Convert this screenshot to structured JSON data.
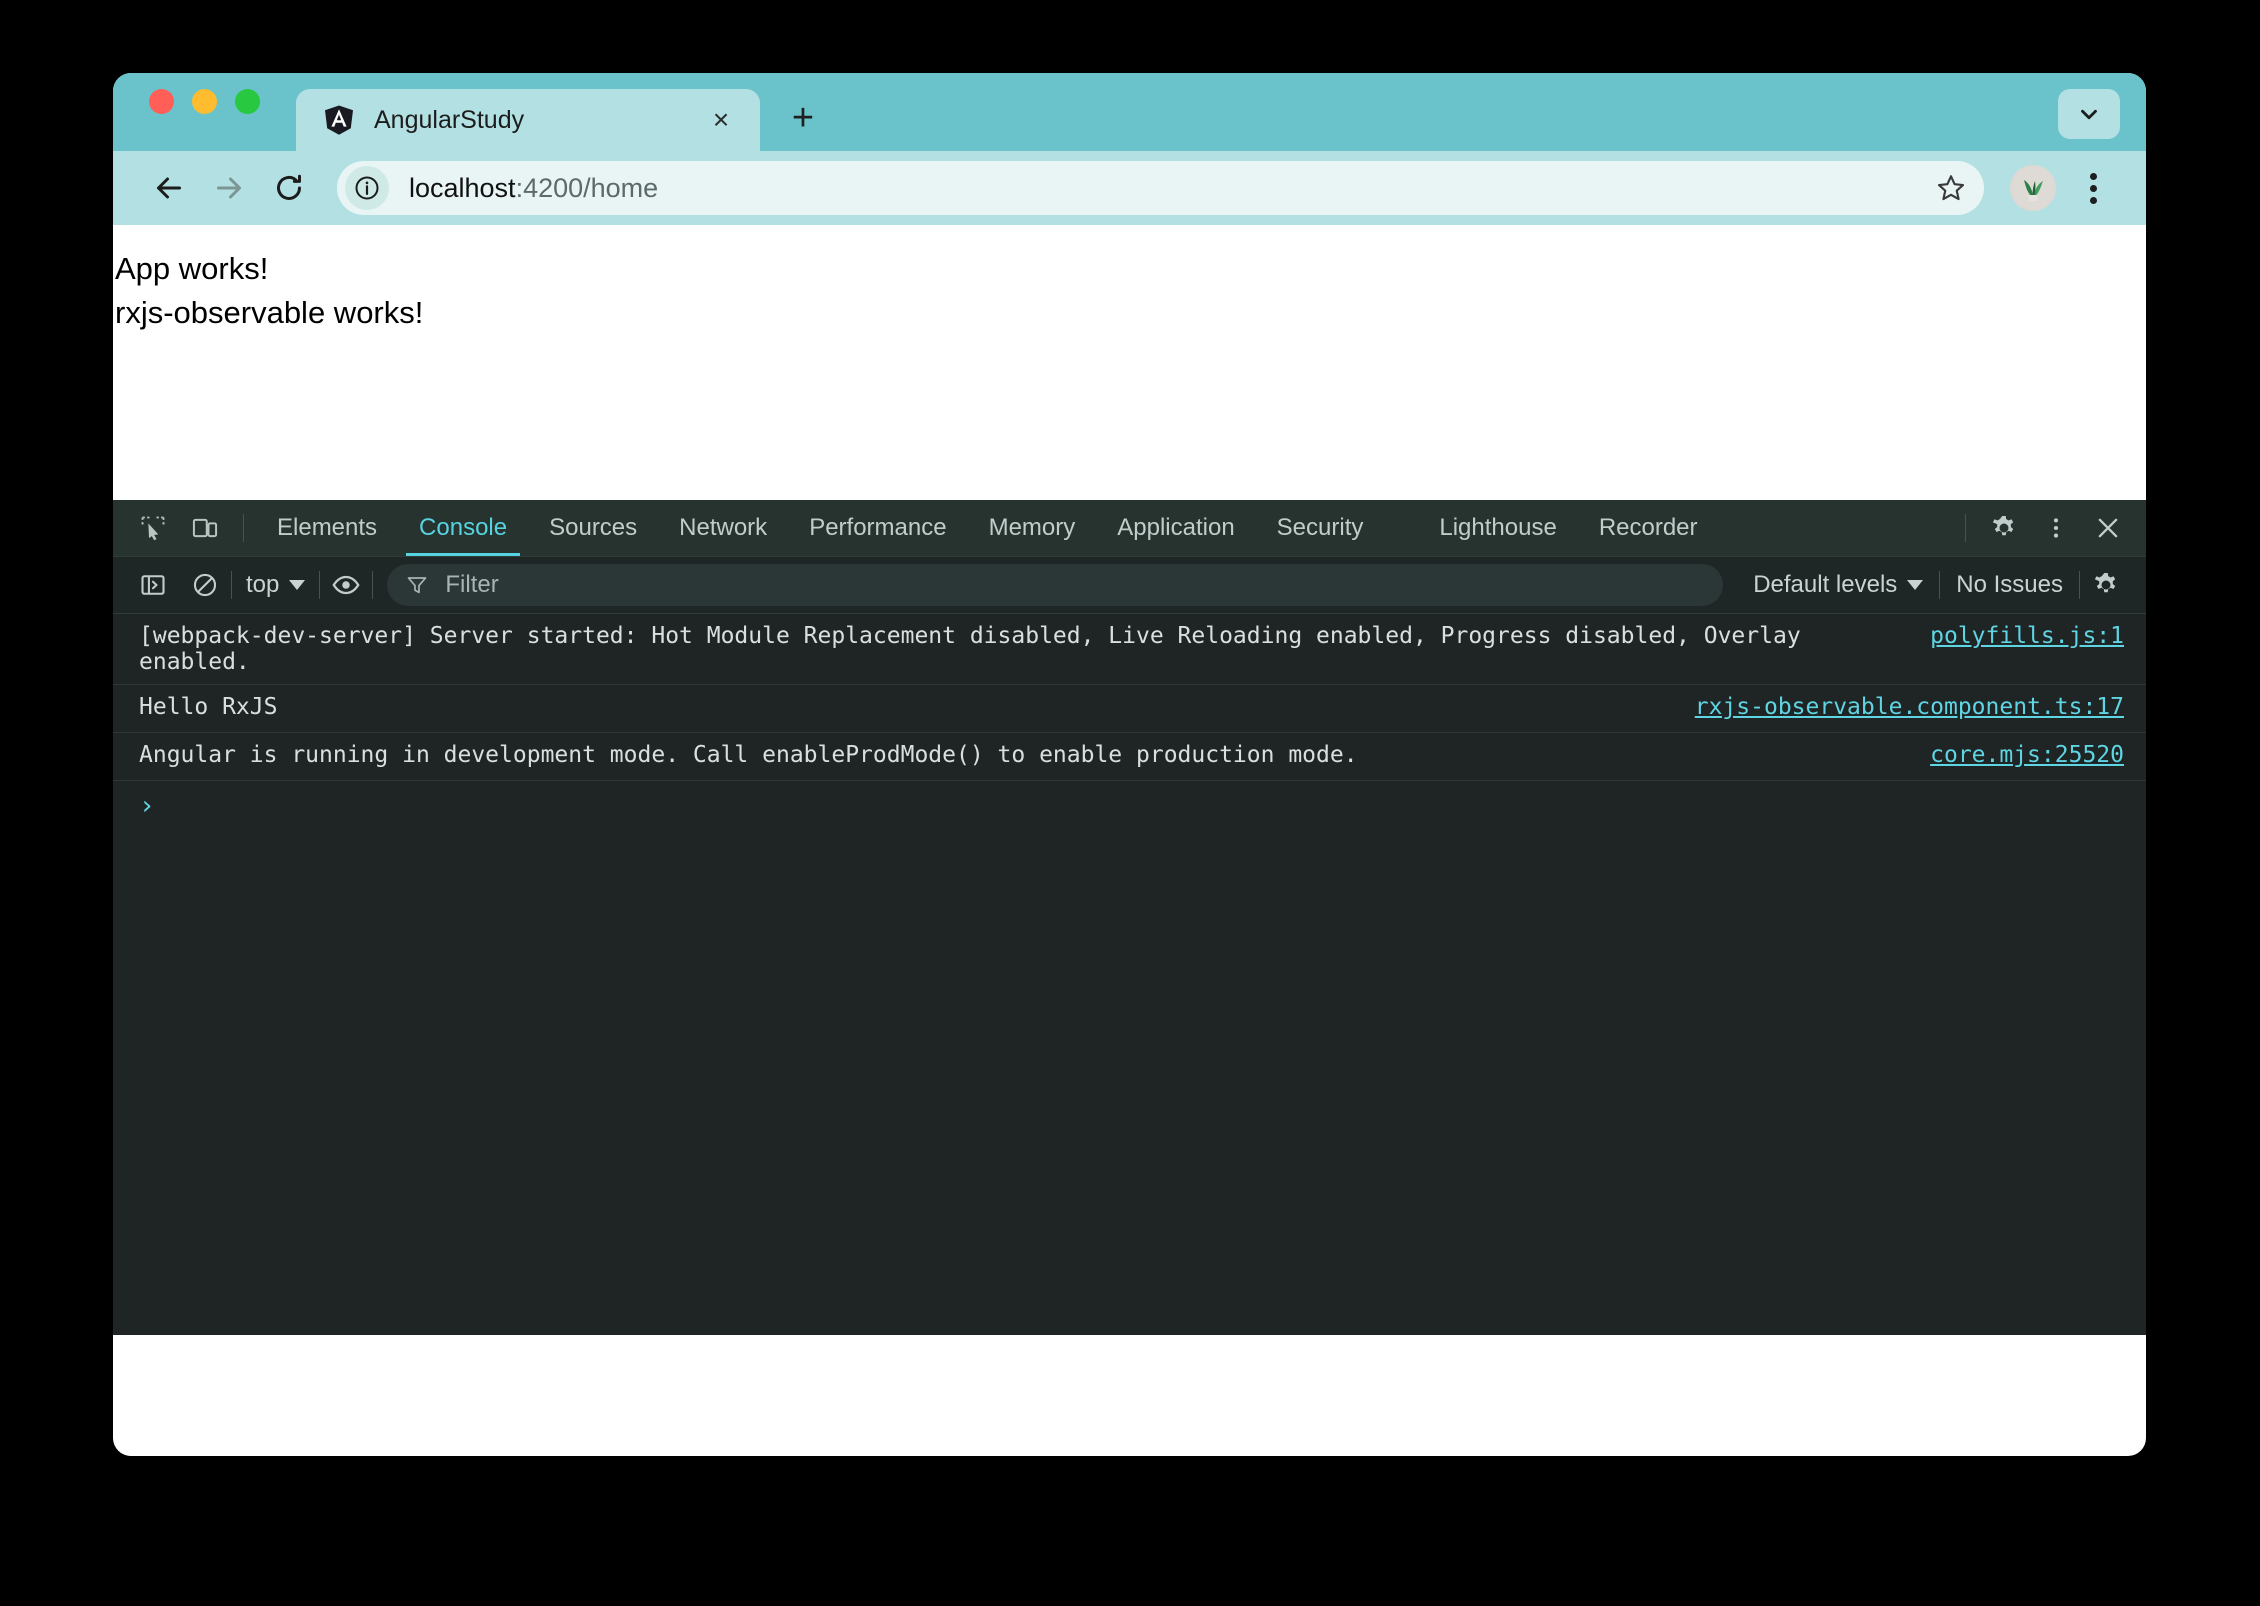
{
  "window": {
    "traffic_lights": [
      "close",
      "minimize",
      "maximize"
    ]
  },
  "tab_strip": {
    "tab": {
      "favicon": "angular-logo-icon",
      "title": "AngularStudy",
      "close_label": "×"
    },
    "new_tab_label": "+",
    "tab_list_icon": "chevron-down-icon"
  },
  "toolbar": {
    "back_icon": "arrow-left-icon",
    "forward_icon": "arrow-right-icon",
    "reload_icon": "reload-icon",
    "site_info_icon": "info-circle-icon",
    "url_host": "localhost",
    "url_rest": ":4200/home",
    "url_full": "localhost:4200/home",
    "star_icon": "star-icon",
    "avatar_icon": "profile-avatar-plant",
    "menu_icon": "kebab-menu-icon"
  },
  "page": {
    "lines": [
      "App works!",
      "rxjs-observable works!"
    ]
  },
  "devtools": {
    "inspect_icon": "inspect-element-icon",
    "device_icon": "device-toolbar-icon",
    "tabs": [
      {
        "label": "Elements",
        "active": false
      },
      {
        "label": "Console",
        "active": true
      },
      {
        "label": "Sources",
        "active": false
      },
      {
        "label": "Network",
        "active": false
      },
      {
        "label": "Performance",
        "active": false
      },
      {
        "label": "Memory",
        "active": false
      },
      {
        "label": "Application",
        "active": false
      },
      {
        "label": "Security",
        "active": false
      }
    ],
    "tabs_secondary": [
      {
        "label": "Lighthouse",
        "active": false
      },
      {
        "label": "Recorder",
        "active": false
      }
    ],
    "settings_icon": "gear-icon",
    "more_icon": "kebab-menu-icon",
    "close_icon": "close-icon",
    "console_toolbar": {
      "sidebar_icon": "console-sidebar-icon",
      "clear_icon": "clear-console-icon",
      "context": "top",
      "context_caret": "chevron-down-icon",
      "eye_icon": "live-expression-eye-icon",
      "filter_icon": "funnel-filter-icon",
      "filter_placeholder": "Filter",
      "filter_value": "",
      "levels": "Default levels",
      "levels_caret": "chevron-down-icon",
      "issues": "No Issues",
      "settings_icon": "gear-icon"
    },
    "messages": [
      {
        "text": "[webpack-dev-server] Server started: Hot Module Replacement disabled, Live Reloading enabled, Progress disabled, Overlay enabled.",
        "source": "polyfills.js:1"
      },
      {
        "text": "Hello RxJS",
        "source": "rxjs-observable.component.ts:17"
      },
      {
        "text": "Angular is running in development mode. Call enableProdMode() to enable production mode.",
        "source": "core.mjs:25520"
      }
    ],
    "prompt_chevron": "›"
  },
  "colors": {
    "browser_chrome": "#6ac3cb",
    "toolbar": "#b2e0e3",
    "devtools_header": "#27332f",
    "devtools_body": "#1f2424",
    "accent_cyan": "#57d2e0",
    "link_cyan": "#5fd4e2"
  }
}
